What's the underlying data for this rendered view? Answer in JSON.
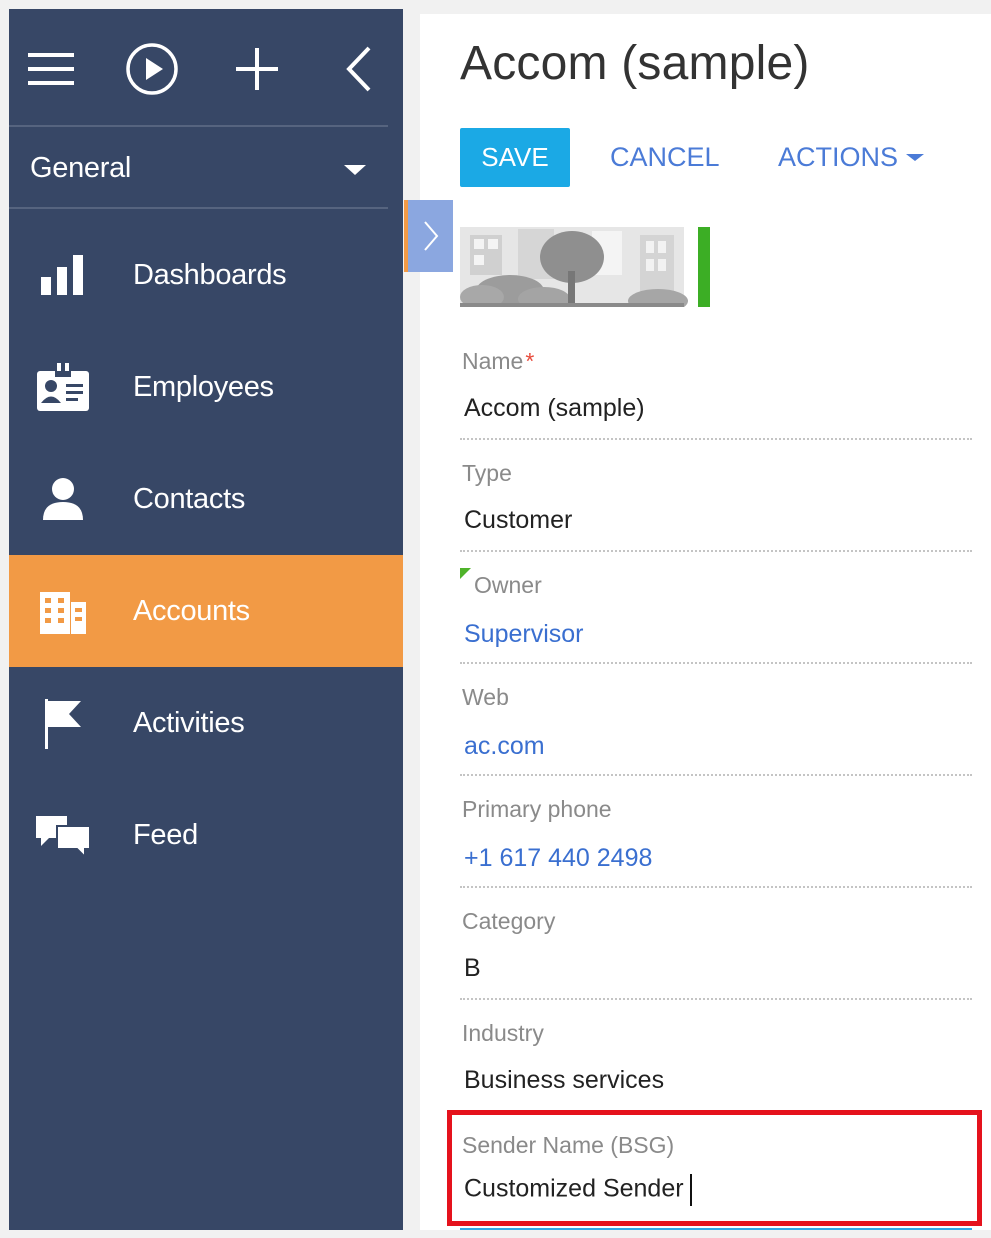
{
  "sidebar": {
    "toolbar": {
      "menu_icon": "hamburger-menu-icon",
      "play_icon": "play-circle-icon",
      "add_icon": "plus-icon",
      "collapse_icon": "chevron-left-icon"
    },
    "section": {
      "label": "General"
    },
    "items": [
      {
        "label": "Dashboards",
        "icon": "bar-chart-icon",
        "active": false
      },
      {
        "label": "Employees",
        "icon": "id-badge-icon",
        "active": false
      },
      {
        "label": "Contacts",
        "icon": "person-icon",
        "active": false
      },
      {
        "label": "Accounts",
        "icon": "building-icon",
        "active": true
      },
      {
        "label": "Activities",
        "icon": "flag-icon",
        "active": false
      },
      {
        "label": "Feed",
        "icon": "chat-bubbles-icon",
        "active": false
      }
    ],
    "active_color": "#f29a45",
    "background_color": "#374766"
  },
  "page": {
    "title": "Accom (sample)",
    "save_label": "SAVE",
    "cancel_label": "CANCEL",
    "actions_label": "ACTIONS",
    "accent_color": "#1ba9e5",
    "link_color": "#4b7bd7"
  },
  "fields": {
    "name": {
      "label": "Name",
      "required_mark": "*",
      "value": "Accom (sample)"
    },
    "type": {
      "label": "Type",
      "value": "Customer"
    },
    "owner": {
      "label": "Owner",
      "value": "Supervisor"
    },
    "web": {
      "label": "Web",
      "value": "ac.com"
    },
    "phone": {
      "label": "Primary phone",
      "value": "+1 617 440 2498"
    },
    "category": {
      "label": "Category",
      "value": "B"
    },
    "industry": {
      "label": "Industry",
      "value": "Business services"
    },
    "sender_name": {
      "label": "Sender Name (BSG)",
      "value": "Customized Sender"
    }
  },
  "highlight_color": "#e5121c"
}
